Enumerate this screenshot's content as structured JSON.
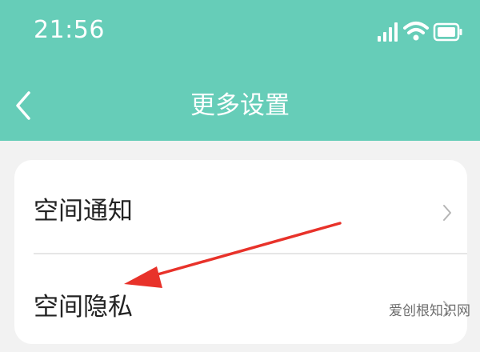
{
  "status_bar": {
    "time": "21:56",
    "icons": [
      "signal-icon",
      "wifi-icon",
      "battery-icon"
    ]
  },
  "header": {
    "title": "更多设置",
    "back_icon": "chevron-left-icon"
  },
  "settings": {
    "items": [
      {
        "label": "空间通知"
      },
      {
        "label": "空间隐私"
      }
    ]
  },
  "annotation": {
    "type": "red-arrow",
    "color": "#e8322a",
    "target": "空间隐私"
  },
  "watermark": {
    "text": "爱创根知识网"
  },
  "colors": {
    "header_bg": "#66cdb8",
    "page_bg": "#f2f2f2",
    "card_bg": "#ffffff",
    "arrow": "#e8322a"
  }
}
